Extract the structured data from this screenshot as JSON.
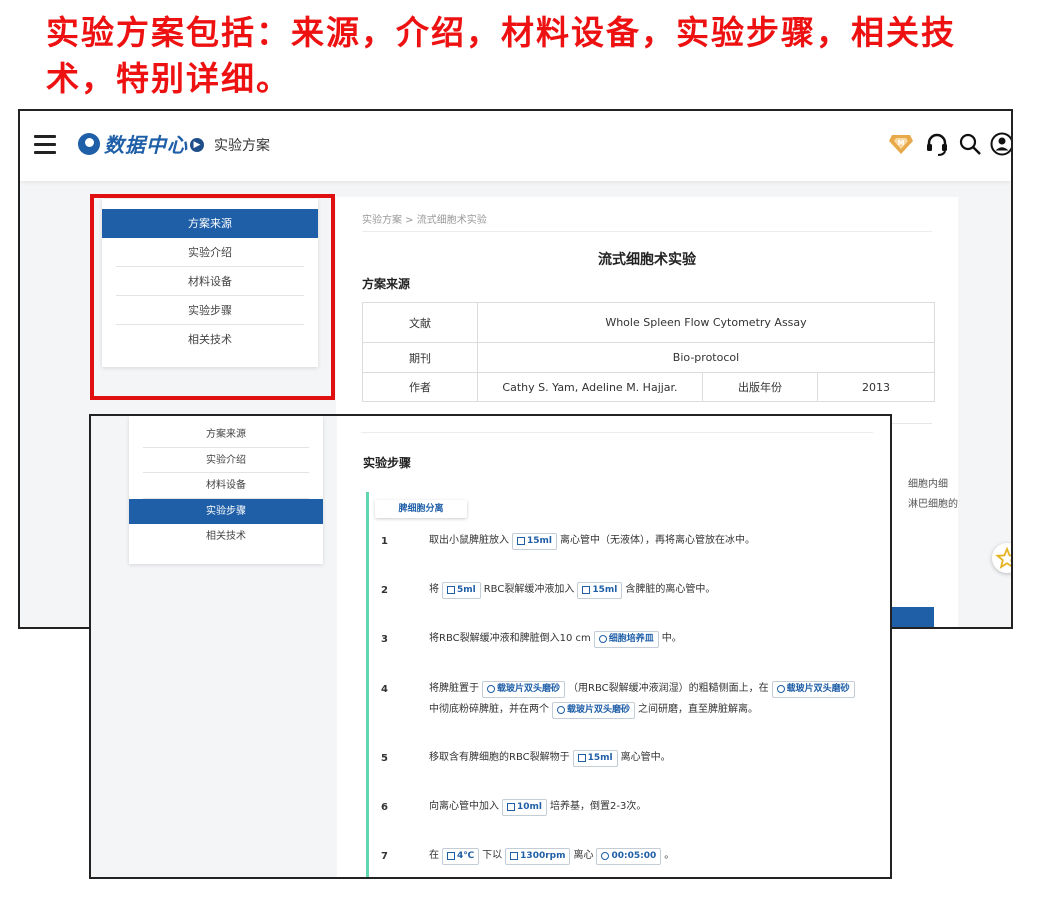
{
  "headline": "实验方案包括：来源，介绍，材料设备，实验步骤，相关技术，特别详细。",
  "topbar": {
    "logo_text": "数据中心",
    "breadcrumb_label": "实验方案"
  },
  "sidebar": {
    "items": [
      "方案来源",
      "实验介绍",
      "材料设备",
      "实验步骤",
      "相关技术"
    ]
  },
  "page1": {
    "breadcrumb": "实验方案 > 流式细胞术实验",
    "title": "流式细胞术实验",
    "section": "方案来源",
    "table": {
      "literature_label": "文献",
      "literature_value": "Whole Spleen Flow Cytometry Assay",
      "journal_label": "期刊",
      "journal_value": "Bio-protocol",
      "author_label": "作者",
      "author_value": "Cathy S. Yam, Adeline M. Hajjar.",
      "year_label": "出版年份",
      "year_value": "2013"
    },
    "faded_text_1": "细胞内细",
    "faded_text_2": "淋巴细胞的"
  },
  "page2": {
    "section": "实验步骤",
    "group_tag": "脾细胞分离",
    "steps": [
      {
        "num": "1",
        "t1": "取出小鼠脾脏放入",
        "c1": "15ml",
        "t2": "离心管中（无液体），再将离心管放在冰中。"
      },
      {
        "num": "2",
        "t1": "将",
        "c1": "5ml",
        "t2": "RBC裂解缓冲液加入",
        "c2": "15ml",
        "t3": "含脾脏的离心管中。"
      },
      {
        "num": "3",
        "t1": "将RBC裂解缓冲液和脾脏倒入10 cm",
        "c1": "细胞培养皿",
        "t2": "中。"
      },
      {
        "num": "4",
        "t1": "将脾脏置于",
        "c1": "载玻片双头磨砂",
        "t2": "（用RBC裂解缓冲液润湿）的粗糙侧面上，在",
        "c2": "载玻片双头磨砂",
        "t3": "中彻底粉碎脾脏，并在两个",
        "c3": "载玻片双头磨砂",
        "t4": "之间研磨，直至脾脏解离。"
      },
      {
        "num": "5",
        "t1": "移取含有脾细胞的RBC裂解物于",
        "c1": "15ml",
        "t2": "离心管中。"
      },
      {
        "num": "6",
        "t1": "向离心管中加入",
        "c1": "10ml",
        "t2": "培养基，倒置2-3次。"
      },
      {
        "num": "7",
        "t1": "在",
        "c1": "4℃",
        "t2": "下以",
        "c2": "1300rpm",
        "t3": "离心",
        "c3": "00:05:00",
        "t4": "。"
      }
    ]
  },
  "colors": {
    "headline": "#ee1111",
    "brand": "#1f5fa8",
    "highlight_border": "#e01010",
    "timeline": "#5fd6b2",
    "vip": "#e8a94a"
  }
}
